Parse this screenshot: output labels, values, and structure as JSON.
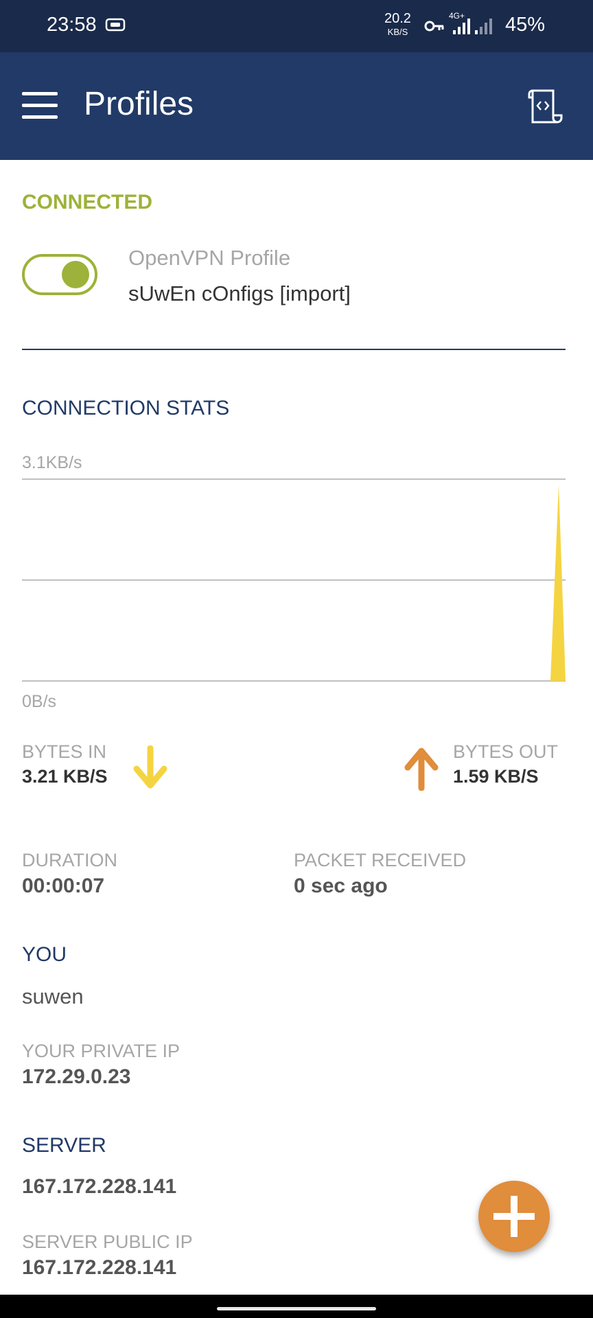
{
  "status_bar": {
    "time": "23:58",
    "net_speed": "20.2",
    "net_speed_unit": "KB/S",
    "network_type": "4G+",
    "battery": "45%"
  },
  "app_bar": {
    "title": "Profiles",
    "menu_icon": "hamburger-menu-icon",
    "import_icon": "import-file-icon"
  },
  "connection": {
    "status": "CONNECTED",
    "status_color": "#9db23a",
    "toggle_on": true,
    "profile_type": "OpenVPN Profile",
    "profile_name": "sUwEn cOnfigs [import]"
  },
  "stats": {
    "title": "CONNECTION STATS",
    "chart_max_label": "3.1KB/s",
    "chart_min_label": "0B/s",
    "bytes_in_label": "BYTES IN",
    "bytes_in_value": "3.21 KB/S",
    "bytes_out_label": "BYTES OUT",
    "bytes_out_value": "1.59 KB/S",
    "duration_label": "DURATION",
    "duration_value": "00:00:07",
    "packet_label": "PACKET RECEIVED",
    "packet_value": "0 sec ago"
  },
  "you": {
    "title": "YOU",
    "username": "suwen",
    "private_ip_label": "YOUR PRIVATE IP",
    "private_ip": "172.29.0.23"
  },
  "server": {
    "title": "SERVER",
    "host": "167.172.228.141",
    "public_ip_label": "SERVER PUBLIC IP",
    "public_ip": "167.172.228.141"
  },
  "colors": {
    "primary": "#213a67",
    "accent_green": "#9db23a",
    "fab": "#e08d3c",
    "bytes_in_arrow": "#f5d442",
    "bytes_out_arrow": "#e08d3c"
  },
  "fab": {
    "icon": "plus-icon"
  }
}
